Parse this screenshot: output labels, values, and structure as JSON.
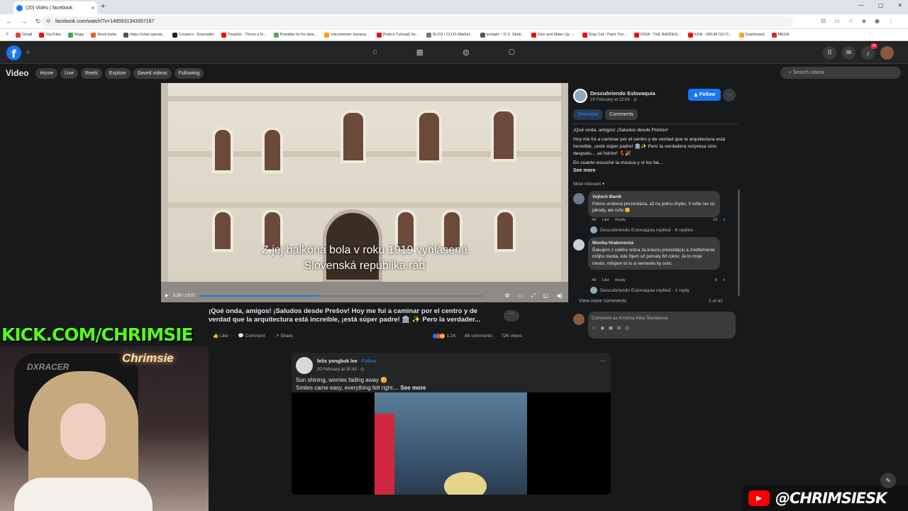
{
  "browser": {
    "tab_title": "(20) Video | facebook",
    "tab_close": "×",
    "new_tab": "+",
    "window_controls": [
      "—",
      "▢",
      "✕"
    ],
    "nav": [
      "←",
      "→",
      "↻"
    ],
    "url": "facebook.com/watch/?v=1485931343357187",
    "bookmarks": [
      "Gmail",
      "YouTube",
      "Mapy",
      "Nová karta",
      "https://chat.openai...",
      "Creators - Keymailer",
      "Tinashe - Throw a Fi...",
      "Possible fix for dela...",
      "voicemeeter banana...",
      "[Twitch Tutorial] Se...",
      "SLOS / CLOS Market...",
      "kontakt ~ D.S. Studi...",
      "Kiss and Make Up -...",
      "Doja Cat - Paint The...",
      "K/DA - THE BADDES...",
      "KDA - DRUM GO D...",
      "Dashboard",
      "MEGA"
    ],
    "bookmark_colors": [
      "#ea4335",
      "#ff0000",
      "#34a853",
      "#ff5722",
      "#555555",
      "#222222",
      "#ff0000",
      "#4caf50",
      "#ff9800",
      "#ff0000",
      "#777777",
      "#555555",
      "#ff0000",
      "#ff0000",
      "#ff0000",
      "#ff0000",
      "#f5a623",
      "#d9272e"
    ]
  },
  "fb_header": {
    "logo": "f",
    "notification_count": "20"
  },
  "subnav": {
    "title": "Video",
    "items": [
      "Home",
      "Live",
      "Reels",
      "Explore",
      "Saved videos",
      "Following"
    ],
    "search_placeholder": "Search videos"
  },
  "video": {
    "subtitle_line1": "Z jej balkóna bola v roku 1919 vyhlásená",
    "subtitle_line2": "Slovenská republika rád",
    "time": "5:28 / 13:07",
    "progress": 0.42
  },
  "post": {
    "caption": "¡Qué onda, amigos! ¡Saludos desde Prešov! Hoy me fui a caminar por el centro y de verdad que la arquitectura está increíble, ¡está súper padre! 🏛️ ✨ Pero la verdader...",
    "more": "···",
    "like": "Like",
    "comment": "Comment",
    "share": "Share",
    "reactions": "1,1K",
    "comments_count": "88 comments",
    "views": "72K views"
  },
  "panel": {
    "page_name": "Descubriendo Eslovaquia",
    "date": "19 February at 22:04 · ◎",
    "follow": "Follow",
    "more": "···",
    "tab_overview": "Overview",
    "tab_comments": "Comments",
    "text_p1": "¡Qué onda, amigos! ¡Saludos desde Prešov!",
    "text_p2": "Hoy me fui a caminar por el centro y de verdad que la arquitectura está increíble, ¡está súper padre! 🏛️✨ Pero la verdadera sorpresa vino después... ¡el folclor! 💃🎉",
    "text_p3": "En cuanto escuché la música y vi los ba...",
    "see_more": "See more",
    "most_relevant": "Most relevant ▾",
    "comments": [
      {
        "author": "Vojtech Maník",
        "text": "Pekne urobená prezentácia, až na jednu chybu. V erbe nie sú jahody, ale ruže.🙂",
        "age": "4d",
        "like": "Like",
        "reply": "Reply",
        "reacts": "10",
        "replies": "Descubriendo Eslovaquia replied · 6 replies"
      },
      {
        "author": "Monika Hrabovecká",
        "text": "Ďakujem z celého srdca za krásnu prezentáciu a zviditeľnenie môjho mesta, kde žijem už pomaly 60 rokov. Je to moje mesto, milujem to tu a nemenila by som.",
        "age": "4d",
        "like": "Like",
        "reply": "Reply",
        "reacts": "9",
        "replies": "Descubriendo Eslovaquia replied · 1 reply"
      }
    ],
    "view_more": "View more comments",
    "page_count": "2 of 42",
    "comment_placeholder": "Comment as Kristína Kika Štyriaková",
    "input_icons": "☺ ◉ ▣ ⊞ ◎"
  },
  "post2": {
    "author": "felix yongbok lee",
    "follow": "· Follow",
    "date": "20 February at 20:43 · ◎",
    "more": "···",
    "line1": "Sun shining, worries fading away 😊",
    "line2": "Smiles came easy, everything felt right....",
    "see_more": "See more"
  },
  "overlay": {
    "kick": "KICK.COM/CHRIMSIE",
    "neon": "Chrimsie",
    "chair_brand": "DXRACER",
    "youtube_handle": "@CHRIMSIESK"
  }
}
